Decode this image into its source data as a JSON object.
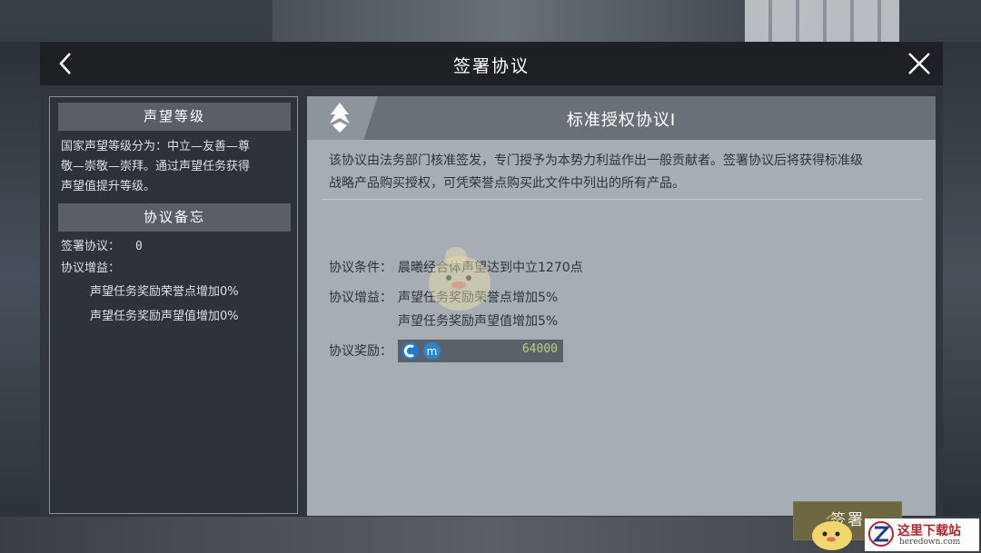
{
  "window": {
    "title": "签署协议"
  },
  "left_panel": {
    "reputation": {
      "header": "声望等级",
      "lines": [
        "国家声望等级分为：中立—友善—尊",
        "敬—崇敬—崇拜。通过声望任务获得",
        "声望值提升等级。"
      ]
    },
    "memo": {
      "header": "协议备忘",
      "signed_label": "签署协议：",
      "signed_value": "0",
      "bonus_label": "协议增益：",
      "bonus_items": [
        "声望任务奖励荣誉点增加0%",
        "声望任务奖励声望值增加0%"
      ]
    }
  },
  "agreement": {
    "title": "标准授权协议I",
    "description_lines": [
      "该协议由法务部门核准签发，专门授予为本势力利益作出一般贡献者。签署协议后将获得标准级",
      "战略产品购买授权，可凭荣誉点购买此文件中列出的所有产品。"
    ],
    "condition_label": "协议条件：",
    "condition_value": "晨曦经合体声望达到中立1270点",
    "bonus_label": "协议增益：",
    "bonus_items": [
      "声望任务奖励荣誉点增加5%",
      "声望任务奖励声望值增加5%"
    ],
    "reward_label": "协议奖励：",
    "reward_icons": [
      "reputation-icon",
      "honor-icon"
    ],
    "reward_value": "64000",
    "sign_button": "签署"
  },
  "watermark": {
    "name": "这里下载站",
    "url": "heredown.com"
  },
  "colors": {
    "reward_value": "#b6d07b",
    "sign_button": "#6e6842",
    "panel": "#a7adb5"
  }
}
